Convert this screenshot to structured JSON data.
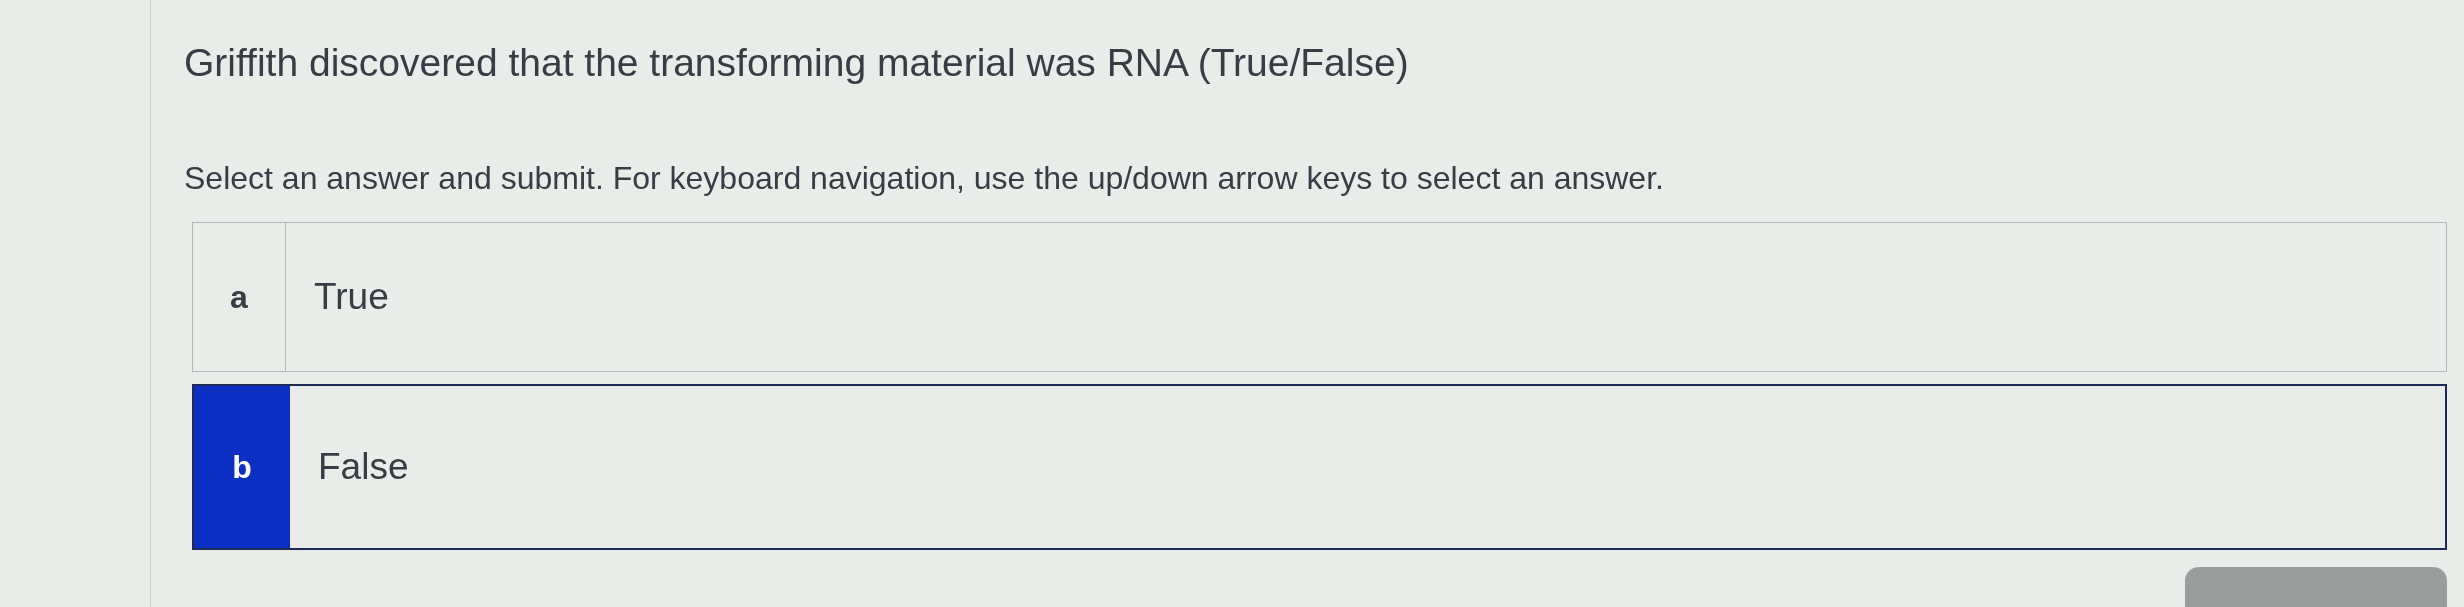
{
  "question": "Griffith discovered that the transforming material was RNA (True/False)",
  "instructions": "Select an answer and submit. For keyboard navigation, use the up/down arrow keys to select an answer.",
  "options": [
    {
      "letter": "a",
      "text": "True",
      "selected": false
    },
    {
      "letter": "b",
      "text": "False",
      "selected": true
    }
  ]
}
